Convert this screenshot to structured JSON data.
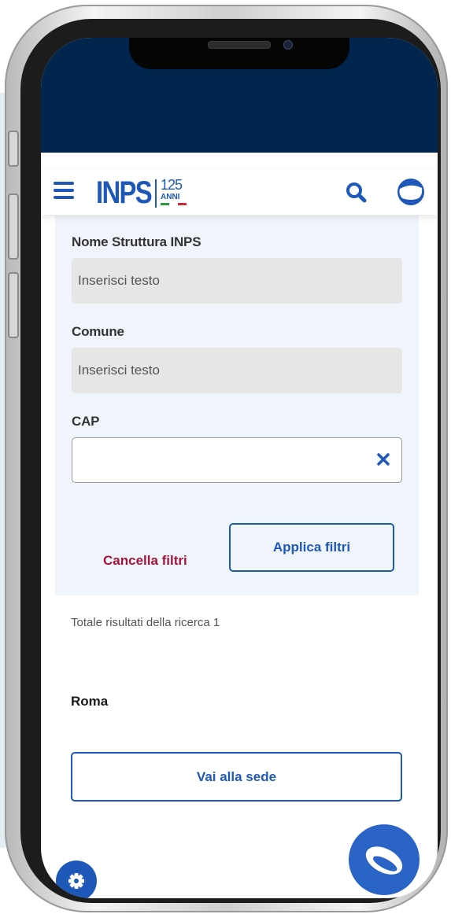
{
  "colors": {
    "brand_blue": "#1e58b8",
    "navy": "#00264d",
    "cancel_red": "#a3163c",
    "panel_bg": "#f0f4fb"
  },
  "header": {
    "logo_text": "INPS",
    "logo_number": "125",
    "logo_sub": "ANNI",
    "icons": [
      "menu-icon",
      "search-icon",
      "user-icon"
    ]
  },
  "filters": {
    "structure": {
      "label": "Nome Struttura INPS",
      "placeholder": "Inserisci testo"
    },
    "city": {
      "label": "Comune",
      "placeholder": "Inserisci testo"
    },
    "zip": {
      "label": "CAP",
      "value": ""
    },
    "cancel_label": "Cancella filtri",
    "apply_label": "Applica filtri"
  },
  "results": {
    "count_text": "Totale risultati della ricerca 1",
    "items": [
      {
        "title": "Roma",
        "button_label": "Vai alla sede"
      }
    ]
  },
  "fabs": {
    "settings_icon": "gear-icon",
    "chat_icon": "chat-icon"
  }
}
